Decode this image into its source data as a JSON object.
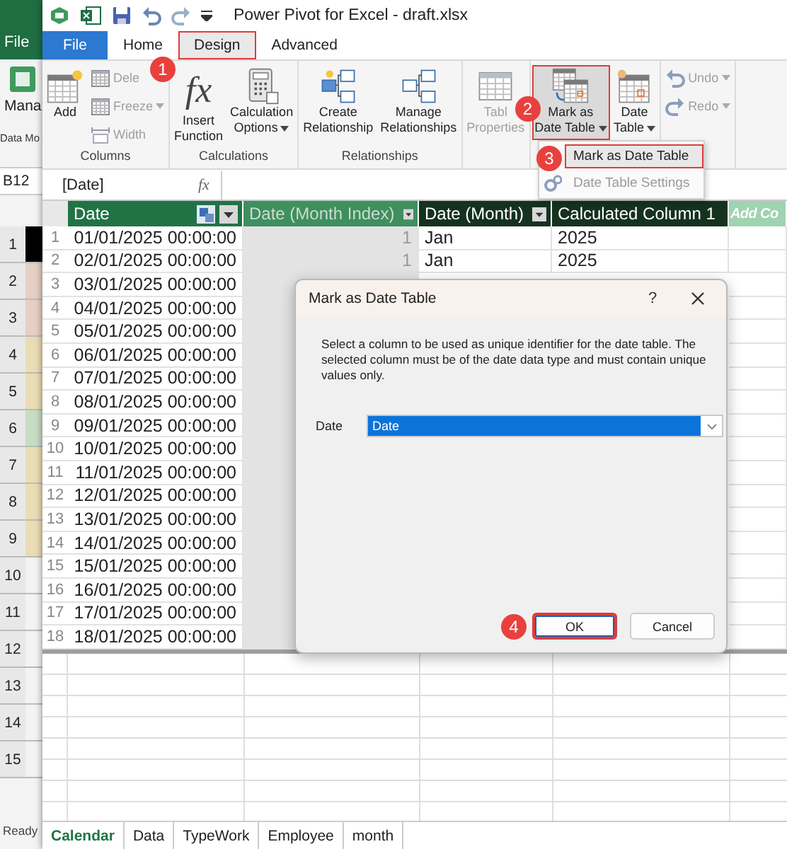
{
  "background_window": {
    "file_tab": "File",
    "manage_button": "Mana",
    "group_label": "Data Mo",
    "name_box": "B12",
    "status": "Ready",
    "row_headers": [
      {
        "number": "1",
        "color": "#000000"
      },
      {
        "number": "2",
        "color": "#e6cfc4"
      },
      {
        "number": "3",
        "color": "#e6cfc4"
      },
      {
        "number": "4",
        "color": "#eadcb4"
      },
      {
        "number": "5",
        "color": "#eadcb4"
      },
      {
        "number": "6",
        "color": "#c9dcc4"
      },
      {
        "number": "7",
        "color": "#eadcb4"
      },
      {
        "number": "8",
        "color": "#eadcb4"
      },
      {
        "number": "9",
        "color": "#eadcb4"
      },
      {
        "number": "10"
      },
      {
        "number": "11"
      },
      {
        "number": "12"
      },
      {
        "number": "13"
      },
      {
        "number": "14"
      },
      {
        "number": "15"
      }
    ]
  },
  "window": {
    "title": "Power Pivot for Excel - draft.xlsx"
  },
  "tabs": [
    {
      "label": "File",
      "kind": "file",
      "selected": false,
      "highlighted": false
    },
    {
      "label": "Home",
      "kind": "tab",
      "selected": false,
      "highlighted": false
    },
    {
      "label": "Design",
      "kind": "tab",
      "selected": true,
      "highlighted": true,
      "callout": "1"
    },
    {
      "label": "Advanced",
      "kind": "tab",
      "selected": false,
      "highlighted": false
    }
  ],
  "ribbon": [
    {
      "label": "Columns",
      "items": [
        {
          "kind": "large",
          "lines": [
            "Add"
          ],
          "disabled": false,
          "dropdown": false,
          "pressed": false,
          "highlighted": false
        },
        {
          "kind": "small",
          "lines": [
            "Dele"
          ],
          "disabled": true,
          "dropdown": false,
          "pressed": false,
          "highlighted": false
        },
        {
          "kind": "small",
          "lines": [
            "Freeze"
          ],
          "disabled": true,
          "dropdown": true,
          "pressed": false,
          "highlighted": false
        },
        {
          "kind": "small",
          "lines": [
            "Width"
          ],
          "disabled": true,
          "dropdown": false,
          "pressed": false,
          "highlighted": false
        }
      ]
    },
    {
      "label": "Calculations",
      "items": [
        {
          "kind": "large",
          "lines": [
            "Insert",
            "Function"
          ],
          "icon_text": "fx",
          "disabled": false,
          "dropdown": false,
          "pressed": false,
          "highlighted": false
        },
        {
          "kind": "large",
          "lines": [
            "Calculation",
            "Options"
          ],
          "disabled": false,
          "dropdown": true,
          "pressed": false,
          "highlighted": false
        }
      ]
    },
    {
      "label": "Relationships",
      "items": [
        {
          "kind": "large",
          "lines": [
            "Create",
            "Relationship"
          ],
          "disabled": false,
          "dropdown": false,
          "pressed": false,
          "highlighted": false
        },
        {
          "kind": "large",
          "lines": [
            "Manage",
            "Relationships"
          ],
          "disabled": false,
          "dropdown": false,
          "pressed": false,
          "highlighted": false
        }
      ]
    },
    {
      "items": [
        {
          "kind": "large",
          "lines": [
            "Tabl",
            "Properties"
          ],
          "disabled": true,
          "dropdown": false,
          "pressed": false,
          "highlighted": false
        }
      ]
    },
    {
      "items": [
        {
          "kind": "large",
          "lines": [
            "Mark as",
            "Date Table"
          ],
          "disabled": false,
          "dropdown": true,
          "pressed": true,
          "highlighted": true,
          "callout": "2"
        },
        {
          "kind": "large",
          "lines": [
            "Date",
            "Table"
          ],
          "disabled": false,
          "dropdown": true,
          "pressed": false,
          "highlighted": false
        }
      ]
    },
    {
      "items": [
        {
          "kind": "small",
          "lines": [
            "Undo"
          ],
          "disabled": true,
          "dropdown": true,
          "pressed": false,
          "highlighted": false
        },
        {
          "kind": "small",
          "lines": [
            "Redo"
          ],
          "disabled": true,
          "dropdown": true,
          "pressed": false,
          "highlighted": false
        }
      ]
    }
  ],
  "menu": {
    "items": [
      {
        "label": "Mark as Date Table",
        "highlighted": true,
        "disabled": false,
        "callout": "3"
      },
      {
        "label": "Date Table Settings",
        "highlighted": false,
        "disabled": true
      }
    ]
  },
  "formula_bar": {
    "reference": "[Date]",
    "function_symbol": "fx"
  },
  "table": {
    "columns": [
      {
        "label": "Date",
        "kind": "data",
        "selected": true,
        "hidden": false
      },
      {
        "label": "Date (Month Index)",
        "kind": "data",
        "selected": false,
        "hidden": true
      },
      {
        "label": "Date (Month)",
        "kind": "calculated",
        "selected": false,
        "hidden": false
      },
      {
        "label": "Calculated Column 1",
        "kind": "calculated",
        "selected": false,
        "hidden": false
      },
      {
        "label": "Add Co",
        "kind": "add",
        "selected": false,
        "hidden": false
      }
    ],
    "rows": [
      {
        "number": "1",
        "cells": [
          "01/01/2025 00:00:00",
          "1",
          "Jan",
          "2025"
        ]
      },
      {
        "number": "2",
        "cells": [
          "02/01/2025 00:00:00",
          "1",
          "Jan",
          "2025"
        ]
      },
      {
        "number": "3",
        "cells": [
          "03/01/2025 00:00:00"
        ]
      },
      {
        "number": "4",
        "cells": [
          "04/01/2025 00:00:00"
        ]
      },
      {
        "number": "5",
        "cells": [
          "05/01/2025 00:00:00"
        ]
      },
      {
        "number": "6",
        "cells": [
          "06/01/2025 00:00:00"
        ]
      },
      {
        "number": "7",
        "cells": [
          "07/01/2025 00:00:00"
        ]
      },
      {
        "number": "8",
        "cells": [
          "08/01/2025 00:00:00"
        ]
      },
      {
        "number": "9",
        "cells": [
          "09/01/2025 00:00:00"
        ]
      },
      {
        "number": "10",
        "cells": [
          "10/01/2025 00:00:00"
        ]
      },
      {
        "number": "11",
        "cells": [
          "11/01/2025 00:00:00"
        ]
      },
      {
        "number": "12",
        "cells": [
          "12/01/2025 00:00:00"
        ]
      },
      {
        "number": "13",
        "cells": [
          "13/01/2025 00:00:00"
        ]
      },
      {
        "number": "14",
        "cells": [
          "14/01/2025 00:00:00"
        ]
      },
      {
        "number": "15",
        "cells": [
          "15/01/2025 00:00:00"
        ]
      },
      {
        "number": "16",
        "cells": [
          "16/01/2025 00:00:00"
        ]
      },
      {
        "number": "17",
        "cells": [
          "17/01/2025 00:00:00"
        ]
      },
      {
        "number": "18",
        "cells": [
          "18/01/2025 00:00:00"
        ]
      }
    ]
  },
  "sheet_tabs": [
    {
      "label": "Calendar",
      "selected": true
    },
    {
      "label": "Data",
      "selected": false
    },
    {
      "label": "TypeWork",
      "selected": false
    },
    {
      "label": "Employee",
      "selected": false
    },
    {
      "label": "month",
      "selected": false
    }
  ],
  "dialog": {
    "title": "Mark as Date Table",
    "help": "?",
    "description": "Select a column to be used as unique identifier for the date table. The selected column must be of the date data type and must contain unique values only.",
    "field_label": "Date",
    "field_value": "Date",
    "field_selected": true,
    "buttons": [
      {
        "label": "OK",
        "highlighted": true,
        "callout": "4"
      },
      {
        "label": "Cancel",
        "highlighted": false
      }
    ]
  }
}
